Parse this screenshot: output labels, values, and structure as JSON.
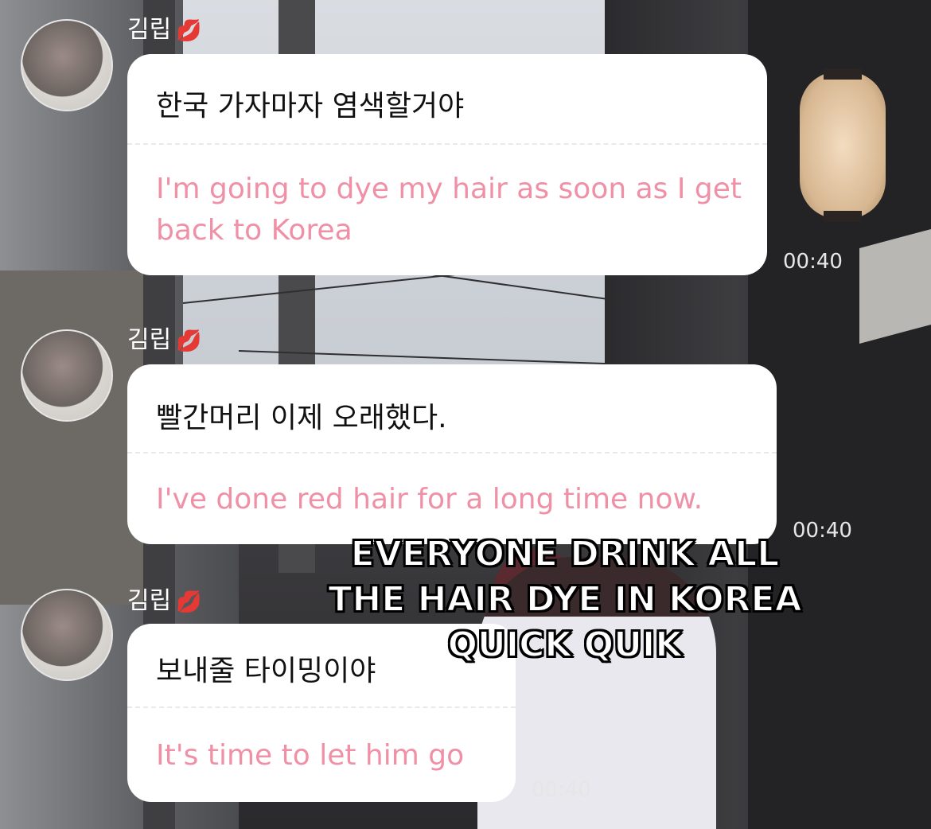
{
  "messages": [
    {
      "sender": "김립",
      "sender_emoji": "💋",
      "korean": "한국 가자마자 염색할거야",
      "english": "I'm going to dye my hair as soon as I get back to Korea",
      "time": "00:40"
    },
    {
      "sender": "김립",
      "sender_emoji": "💋",
      "korean": "빨간머리 이제 오래했다.",
      "english": "I've done red hair for a long time now.",
      "time": "00:40"
    },
    {
      "sender": "김립",
      "sender_emoji": "💋",
      "korean": "보내줄 타이밍이야",
      "english": "It's time to let him go",
      "time": "00:40"
    }
  ],
  "caption": {
    "line1": "EVERYONE DRINK ALL",
    "line2": "THE HAIR DYE IN KOREA",
    "line3": "QUICK QUIK"
  },
  "colors": {
    "translation_text": "#ef90a6",
    "bubble_bg": "#ffffff",
    "lips_emoji": "#d01a2a"
  }
}
